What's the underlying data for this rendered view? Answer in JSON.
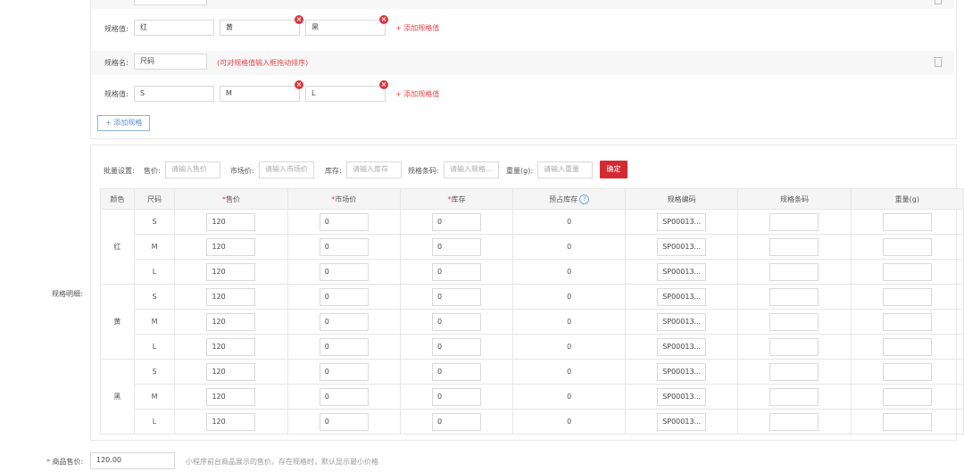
{
  "spec_group_color": {
    "value_label": "规格值:",
    "values": [
      "红",
      "黄",
      "黑"
    ],
    "add_value_link": "+ 添加规格值"
  },
  "spec_group_size": {
    "name_label": "规格名:",
    "name_value": "尺码",
    "drag_hint": "(可对规格值输入框拖动排序)",
    "value_label": "规格值:",
    "values": [
      "S",
      "M",
      "L"
    ],
    "add_value_link": "+ 添加规格值"
  },
  "add_spec_button": "+ 添加规格",
  "batch": {
    "title": "批量设置:",
    "price_label": "售价:",
    "price_placeholder": "请输入售价",
    "market_label": "市场价:",
    "market_placeholder": "请输入市场价",
    "stock_label": "库存:",
    "stock_placeholder": "请输入库存",
    "barcode_label": "规格条码:",
    "barcode_placeholder": "请输入规格...",
    "weight_label": "重量(g):",
    "weight_placeholder": "请输入重量",
    "confirm_button": "确定"
  },
  "spec_detail_label": "规格明细:",
  "table": {
    "headers": {
      "color": "颜色",
      "size": "尺码",
      "price": "售价",
      "market": "市场价",
      "stock": "库存",
      "presale": "预占库存",
      "code": "规格编码",
      "barcode": "规格条码",
      "weight": "重量(g)"
    },
    "required_mark": "*",
    "help_icon": "?",
    "groups": [
      {
        "color": "红",
        "rows": [
          {
            "size": "S",
            "price": "120",
            "market": "0",
            "stock": "0",
            "presale": "0",
            "code": "SP00013...",
            "barcode": "",
            "weight": ""
          },
          {
            "size": "M",
            "price": "120",
            "market": "0",
            "stock": "0",
            "presale": "0",
            "code": "SP00013...",
            "barcode": "",
            "weight": ""
          },
          {
            "size": "L",
            "price": "120",
            "market": "0",
            "stock": "0",
            "presale": "0",
            "code": "SP00013...",
            "barcode": "",
            "weight": ""
          }
        ]
      },
      {
        "color": "黄",
        "rows": [
          {
            "size": "S",
            "price": "120",
            "market": "0",
            "stock": "0",
            "presale": "0",
            "code": "SP00013...",
            "barcode": "",
            "weight": ""
          },
          {
            "size": "M",
            "price": "120",
            "market": "0",
            "stock": "0",
            "presale": "0",
            "code": "SP00013...",
            "barcode": "",
            "weight": ""
          },
          {
            "size": "L",
            "price": "120",
            "market": "0",
            "stock": "0",
            "presale": "0",
            "code": "SP00013...",
            "barcode": "",
            "weight": ""
          }
        ]
      },
      {
        "color": "黑",
        "rows": [
          {
            "size": "S",
            "price": "120",
            "market": "0",
            "stock": "0",
            "presale": "0",
            "code": "SP00013...",
            "barcode": "",
            "weight": ""
          },
          {
            "size": "M",
            "price": "120",
            "market": "0",
            "stock": "0",
            "presale": "0",
            "code": "SP00013...",
            "barcode": "",
            "weight": ""
          },
          {
            "size": "L",
            "price": "120",
            "market": "0",
            "stock": "0",
            "presale": "0",
            "code": "SP00013...",
            "barcode": "",
            "weight": ""
          }
        ]
      }
    ]
  },
  "goods_price": {
    "required_mark": "*",
    "label": "商品售价:",
    "value": "120.00",
    "hint": "小程序前台商品展示的售价，存在规格时，默认显示最小价格"
  },
  "icons": {
    "remove_value": "remove-value-icon",
    "trash": "trash-icon",
    "help": "help-icon"
  },
  "colors": {
    "danger": "#d9363e",
    "link_red": "#e0464b",
    "confirm_button": "#d42a33",
    "outline_blue": "#5b8fd6"
  }
}
